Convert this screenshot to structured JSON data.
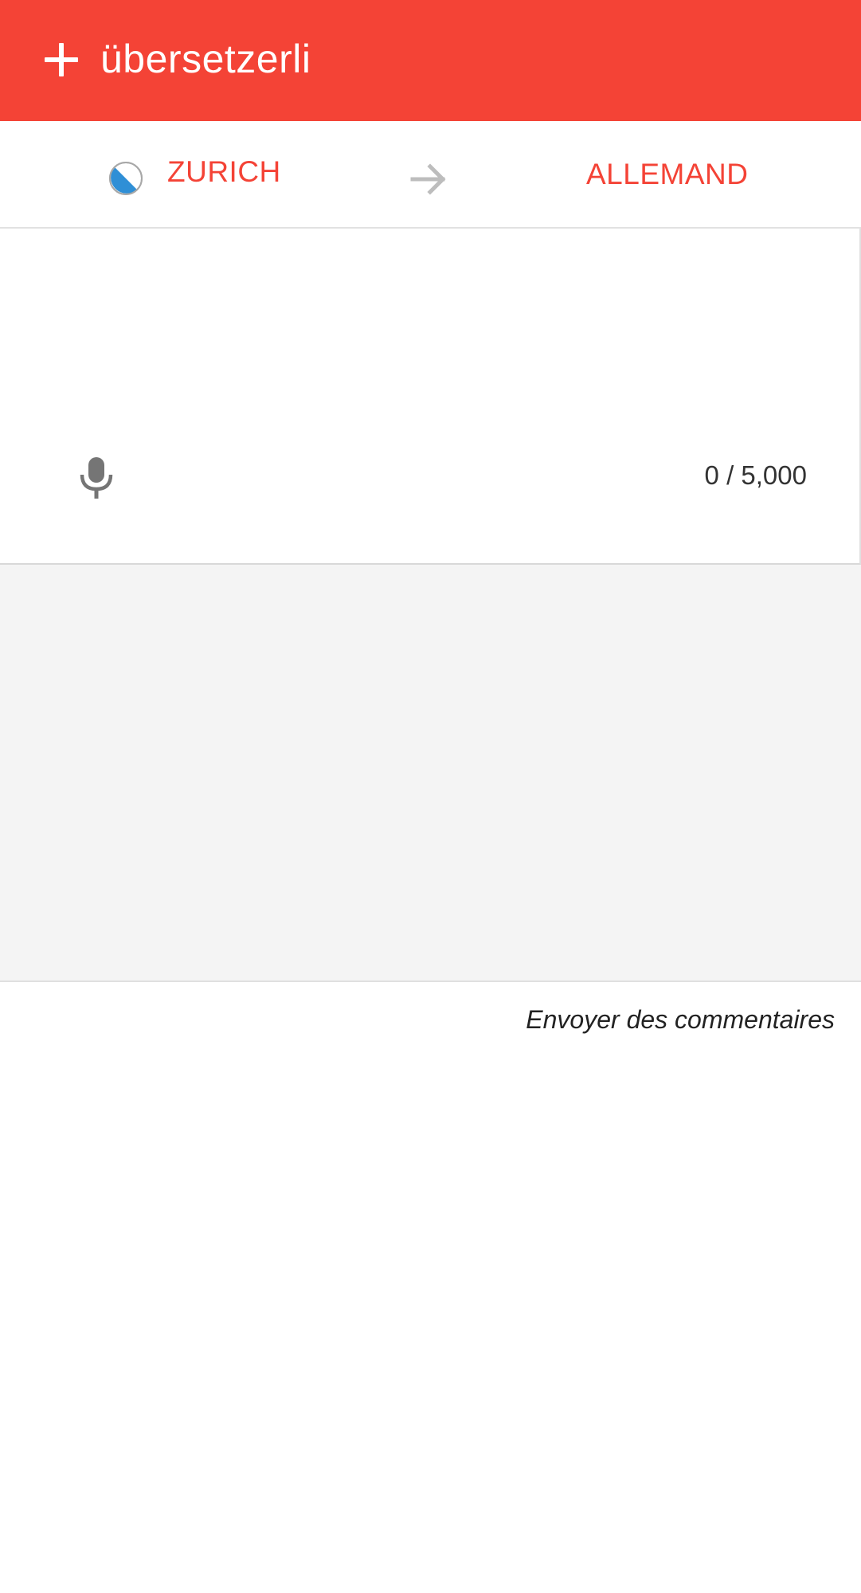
{
  "app": {
    "title": "übersetzerli",
    "add_icon": "plus-icon"
  },
  "language_bar": {
    "source_label": "ZURICH",
    "source_flag_icon": "zurich-flag-icon",
    "swap_icon": "arrow-right-icon",
    "target_label": "ALLEMAND"
  },
  "input": {
    "value": "",
    "mic_icon": "microphone-icon",
    "char_count": "0 / 5,000"
  },
  "footer": {
    "feedback_link": "Envoyer des commentaires"
  },
  "colors": {
    "accent": "#f44336",
    "output_bg": "#f4f4f4",
    "flag_blue": "#2f8fd6"
  }
}
